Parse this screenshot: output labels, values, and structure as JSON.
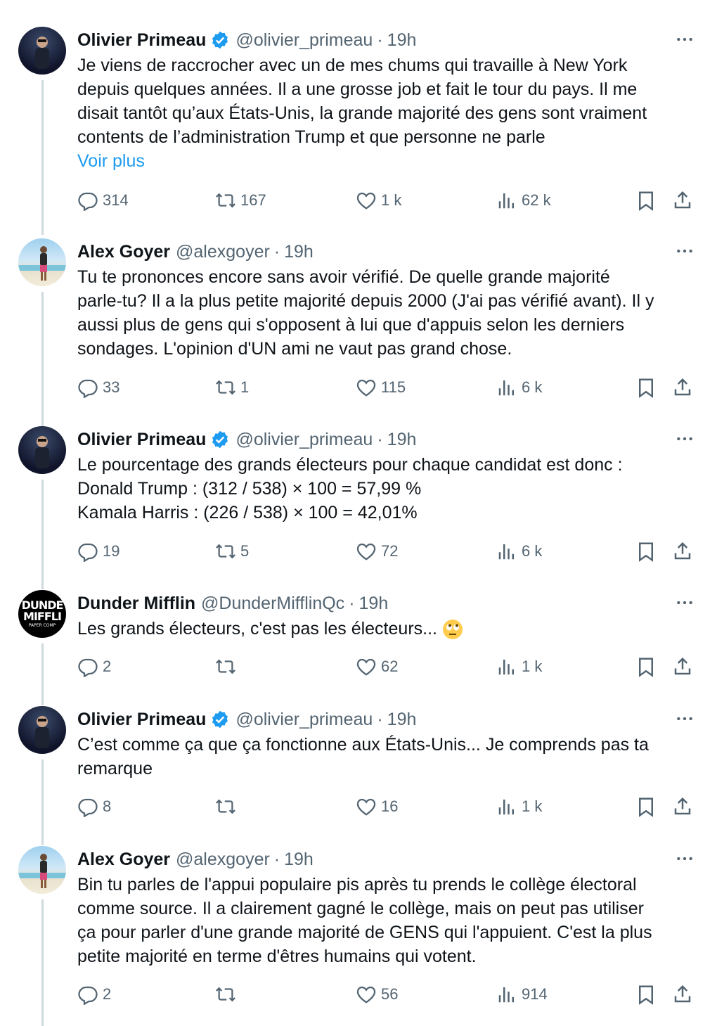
{
  "tweets": [
    {
      "name": "Olivier Primeau",
      "verified": true,
      "handle": "@olivier_primeau",
      "time": "19h",
      "lines": [
        "Je viens de raccrocher avec un de mes chums qui travaille à New York",
        "depuis quelques années. Il a une grosse job et fait le tour du pays. Il me",
        "disait tantôt qu’aux États-Unis, la grande majorité des gens sont vraiment",
        "contents de l’administration Trump et que personne ne parle"
      ],
      "more_link": "Voir plus",
      "replies": "314",
      "retweets": "167",
      "likes": "1 k",
      "views": "62 k"
    },
    {
      "name": "Alex Goyer",
      "verified": false,
      "handle": "@alexgoyer",
      "time": "19h",
      "lines": [
        "Tu te prononces encore sans avoir vérifié. De quelle grande majorité",
        "parle-tu? Il a la plus petite majorité depuis 2000 (J'ai pas vérifié avant). Il y",
        "aussi plus de gens qui s'opposent à lui que d'appuis selon les derniers",
        "sondages. L'opinion d'UN ami ne vaut pas grand chose."
      ],
      "replies": "33",
      "retweets": "1",
      "likes": "115",
      "views": "6 k"
    },
    {
      "name": "Olivier Primeau",
      "verified": true,
      "handle": "@olivier_primeau",
      "time": "19h",
      "lines": [
        "Le pourcentage des grands électeurs pour chaque candidat est donc :",
        "Donald Trump : (312 / 538) × 100 = 57,99 %",
        "Kamala Harris : (226 / 538) × 100 = 42,01%"
      ],
      "replies": "19",
      "retweets": "5",
      "likes": "72",
      "views": "6 k"
    },
    {
      "name": "Dunder Mifflin",
      "verified": false,
      "handle": "@DunderMifflinQc",
      "time": "19h",
      "lines": [
        "Les grands électeurs, c'est pas les électeurs..."
      ],
      "emoji": "eye-roll-emoji",
      "avatar_text": [
        "DUNDE",
        "MIFFLI",
        "PAPER COMP"
      ],
      "replies": "2",
      "retweets": "",
      "likes": "62",
      "views": "1 k"
    },
    {
      "name": "Olivier Primeau",
      "verified": true,
      "handle": "@olivier_primeau",
      "time": "19h",
      "lines": [
        "C’est comme ça que ça fonctionne aux États-Unis... Je comprends pas ta",
        "remarque"
      ],
      "replies": "8",
      "retweets": "",
      "likes": "16",
      "views": "1 k"
    },
    {
      "name": "Alex Goyer",
      "verified": false,
      "handle": "@alexgoyer",
      "time": "19h",
      "lines": [
        "Bin tu parles de l'appui populaire pis après tu prends le collège électoral",
        "comme source. Il a clairement gagné le collège, mais on peut pas utiliser",
        "ça pour parler d'une grande majorité de GENS qui l'appuient. C'est la plus",
        "petite majorité en terme d'êtres humains qui votent."
      ],
      "replies": "2",
      "retweets": "",
      "likes": "56",
      "views": "914"
    }
  ],
  "colors": {
    "text": "#0f1419",
    "muted": "#536471",
    "link": "#1d9bf0",
    "verified": "#1d9bf0",
    "thread": "#cfd9de"
  }
}
